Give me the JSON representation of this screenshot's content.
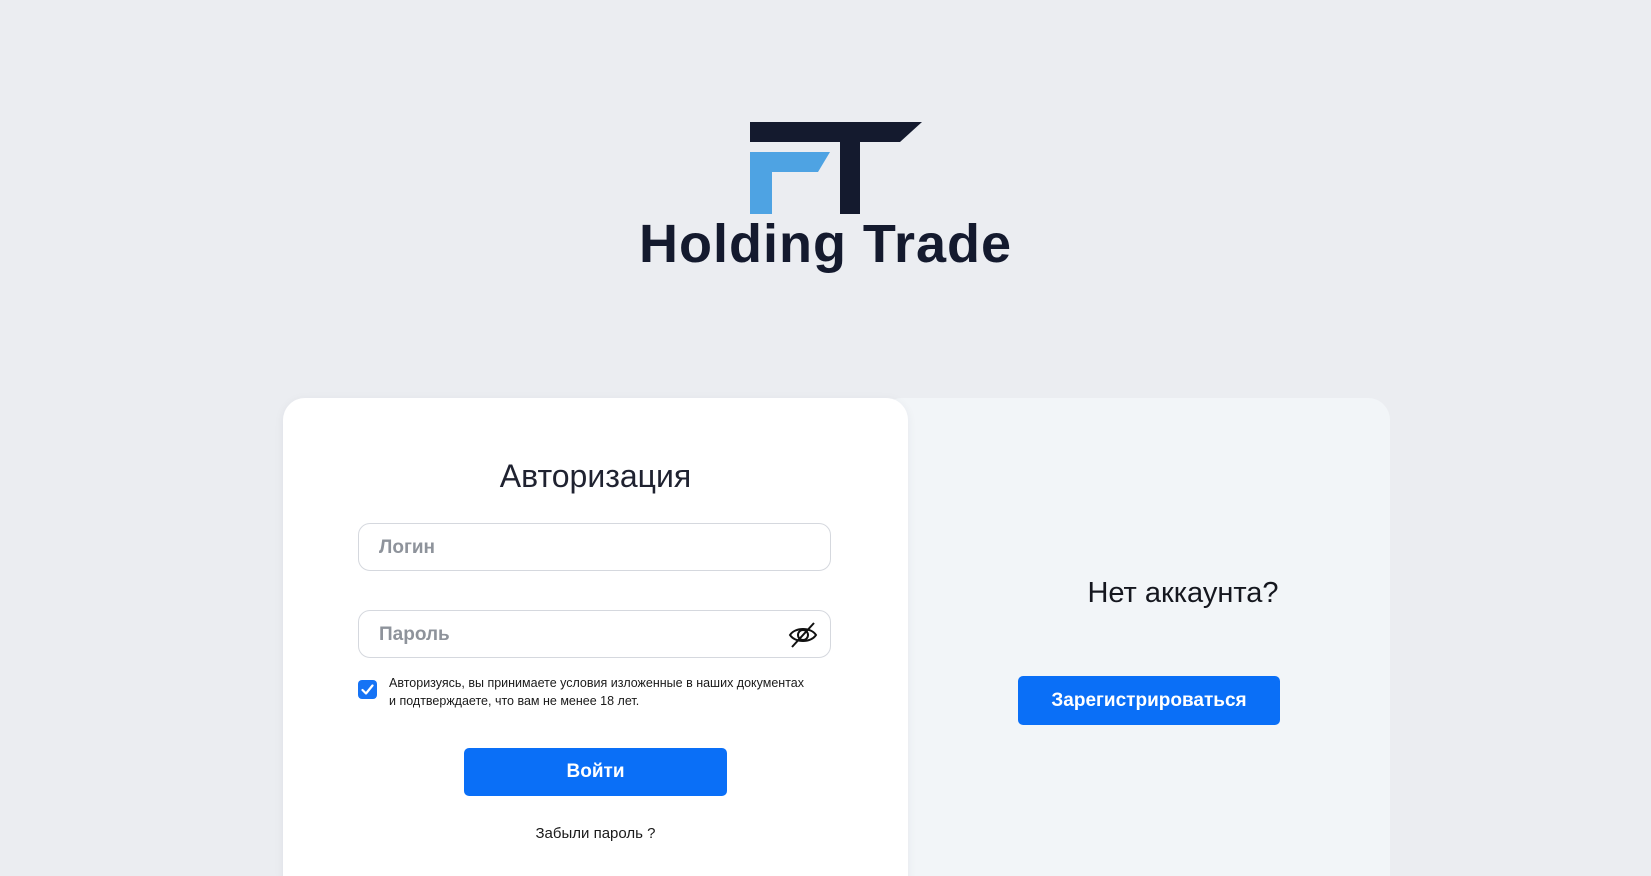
{
  "brand": {
    "name": "Holding Trade",
    "colors": {
      "dark": "#141a2e",
      "accent": "#4ea3e3"
    }
  },
  "login": {
    "title": "Авторизация",
    "login_placeholder": "Логин",
    "password_placeholder": "Пароль",
    "consent_checked": true,
    "consent_line1": "Авторизуясь, вы принимаете условия изложенные в наших документах",
    "consent_line2": "и подтверждаете, что вам не менее 18 лет.",
    "submit_label": "Войти",
    "forgot_label": "Забыли пароль ?"
  },
  "register": {
    "prompt": "Нет аккаунта?",
    "button_label": "Зарегистрироваться"
  },
  "colors": {
    "primary_button": "#0a6ff7",
    "background": "#ebedf1"
  }
}
